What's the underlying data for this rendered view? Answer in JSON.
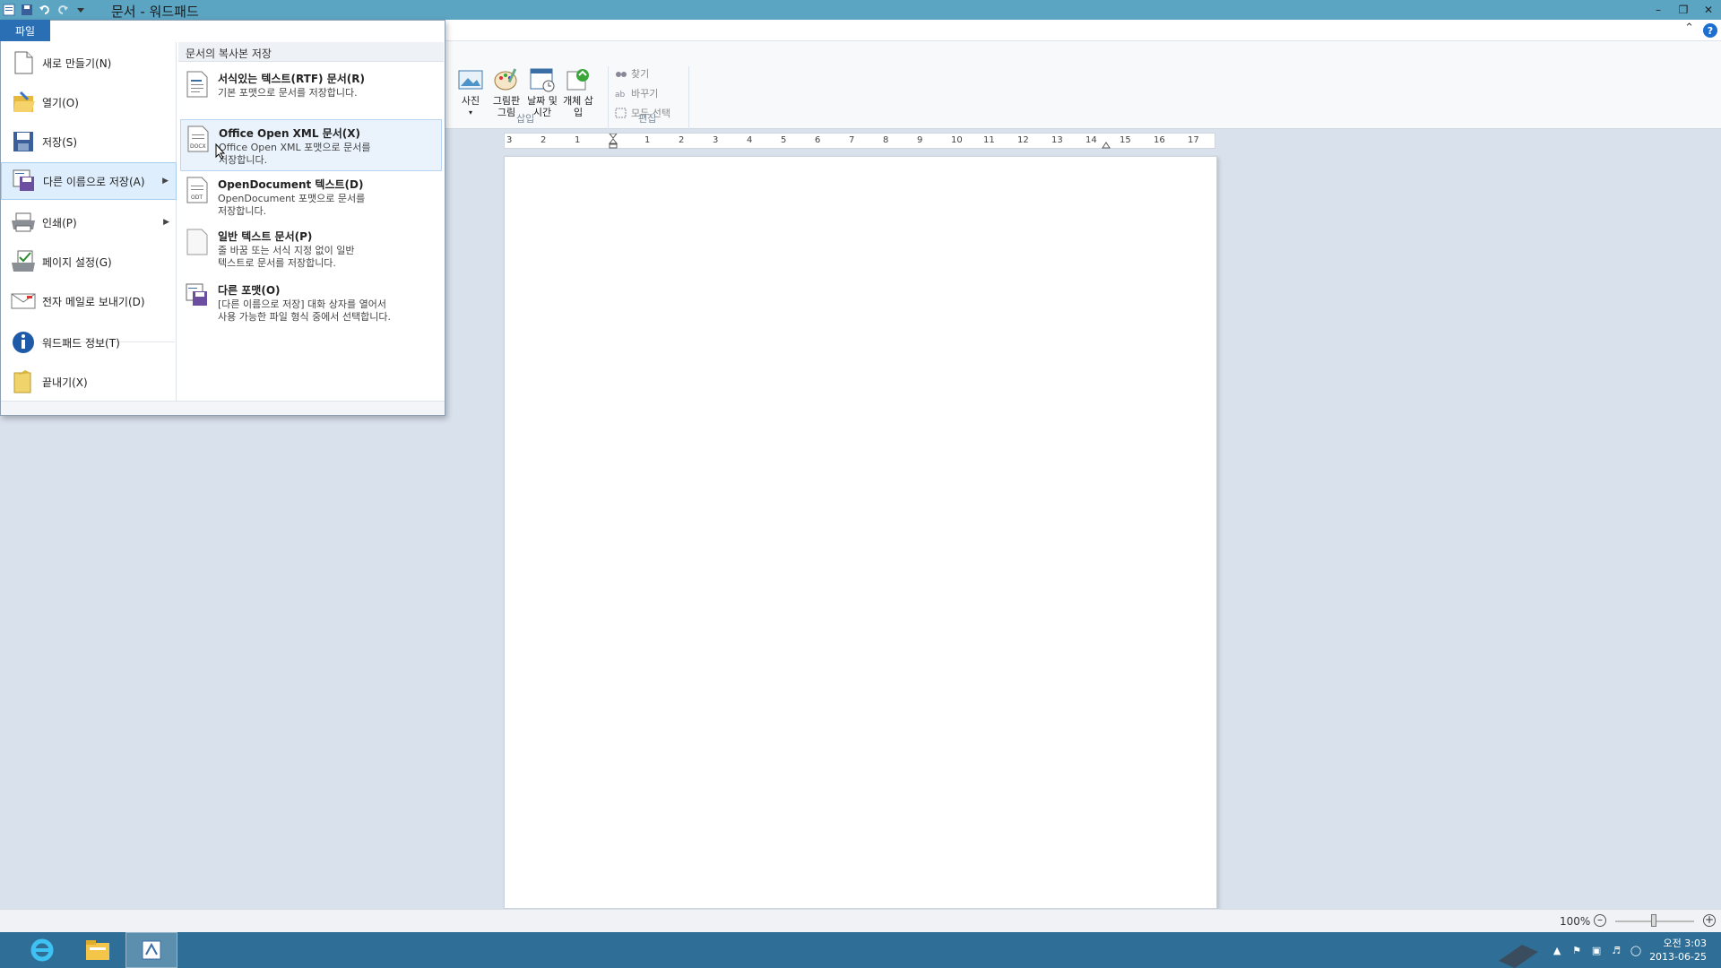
{
  "window": {
    "title": "문서 - 워드패드"
  },
  "ribbon": {
    "file_tab": "파일",
    "insert": {
      "picture": "사진",
      "paint": "그림판 그림",
      "datetime": "날짜 및 시간",
      "object": "개체 삽입",
      "group_label": "삽입"
    },
    "edit": {
      "find": "찾기",
      "replace": "바꾸기",
      "select_all": "모두 선택",
      "group_label": "편집"
    },
    "help": "?"
  },
  "ruler": {
    "labels": [
      "3",
      "2",
      "1",
      "1",
      "2",
      "3",
      "4",
      "5",
      "6",
      "7",
      "8",
      "9",
      "10",
      "11",
      "12",
      "13",
      "14",
      "15",
      "16",
      "17"
    ]
  },
  "file_menu": {
    "items": [
      {
        "label": "새로 만들기(N)"
      },
      {
        "label": "열기(O)"
      },
      {
        "label": "저장(S)"
      },
      {
        "label": "다른 이름으로 저장(A)"
      },
      {
        "label": "인쇄(P)"
      },
      {
        "label": "페이지 설정(G)"
      },
      {
        "label": "전자 메일로 보내기(D)"
      },
      {
        "label": "워드패드 정보(T)"
      },
      {
        "label": "끝내기(X)"
      }
    ],
    "submenu": {
      "heading": "문서의 복사본 저장",
      "options": [
        {
          "title": "서식있는 텍스트(RTF) 문서(R)",
          "desc1": "기본 포맷으로 문서를 저장합니다.",
          "desc2": ""
        },
        {
          "title": "Office Open XML 문서(X)",
          "desc1": "Office Open XML 포맷으로 문서를",
          "desc2": "저장합니다."
        },
        {
          "title": "OpenDocument 텍스트(D)",
          "desc1": "OpenDocument 포맷으로 문서를",
          "desc2": "저장합니다."
        },
        {
          "title": "일반 텍스트 문서(P)",
          "desc1": "줄 바꿈 또는 서식 지정 없이 일반",
          "desc2": "텍스트로 문서를 저장합니다."
        },
        {
          "title": "다른 포맷(O)",
          "desc1": "[다른 이름으로 저장] 대화 상자를 열어서",
          "desc2": "사용 가능한 파일 형식 중에서 선택합니다."
        }
      ]
    }
  },
  "status": {
    "zoom": "100%"
  },
  "taskbar": {
    "time": "오전 3:03",
    "date": "2013-06-25"
  }
}
